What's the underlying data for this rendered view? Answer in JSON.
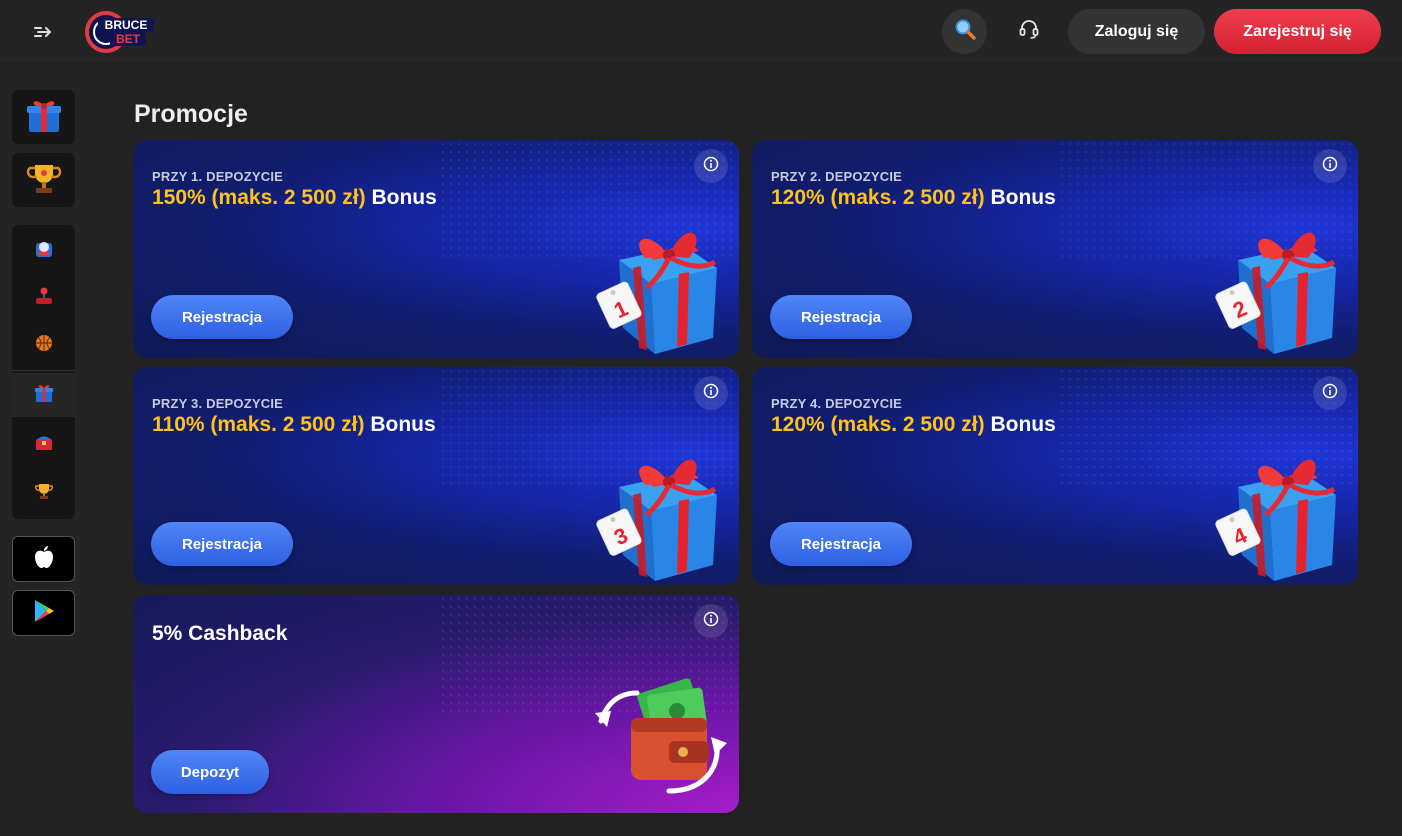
{
  "header": {
    "logo_text_top": "BRUCE",
    "logo_text_bottom": "BET",
    "login_label": "Zaloguj się",
    "register_label": "Zarejestruj się",
    "icons": [
      "menu-expand-icon",
      "search-icon",
      "headset-support-icon"
    ]
  },
  "sidebar": {
    "top_tiles": [
      {
        "name": "gift-icon"
      },
      {
        "name": "trophy-icon"
      }
    ],
    "group_items": [
      {
        "name": "slot-machine-icon"
      },
      {
        "name": "joystick-icon"
      },
      {
        "name": "basketball-icon"
      },
      {
        "name": "gift-icon",
        "active": true
      },
      {
        "name": "treasure-chest-icon"
      },
      {
        "name": "trophy-icon"
      }
    ],
    "apps": [
      {
        "name": "apple-icon"
      },
      {
        "name": "google-play-icon"
      }
    ]
  },
  "page": {
    "title": "Promocje"
  },
  "promos": [
    {
      "pre": "PRZY 1. DEPOZYCIE",
      "accent": "150% (maks. 2 500 zł)",
      "rest": "Bonus",
      "cta": "Rejestracja",
      "tag_number": "1"
    },
    {
      "pre": "PRZY 2. DEPOZYCIE",
      "accent": "120% (maks. 2 500 zł)",
      "rest": "Bonus",
      "cta": "Rejestracja",
      "tag_number": "2"
    },
    {
      "pre": "PRZY 3. DEPOZYCIE",
      "accent": "110% (maks. 2 500 zł)",
      "rest": "Bonus",
      "cta": "Rejestracja",
      "tag_number": "3"
    },
    {
      "pre": "PRZY 4. DEPOZYCIE",
      "accent": "120% (maks. 2 500 zł)",
      "rest": "Bonus",
      "cta": "Rejestracja",
      "tag_number": "4"
    }
  ],
  "cashback": {
    "title": "5% Cashback",
    "cta": "Depozyt"
  },
  "colors": {
    "background": "#222222",
    "accent_yellow": "#ffc21a",
    "register_red": "#e2303f",
    "cta_blue": "#3d70ee"
  }
}
